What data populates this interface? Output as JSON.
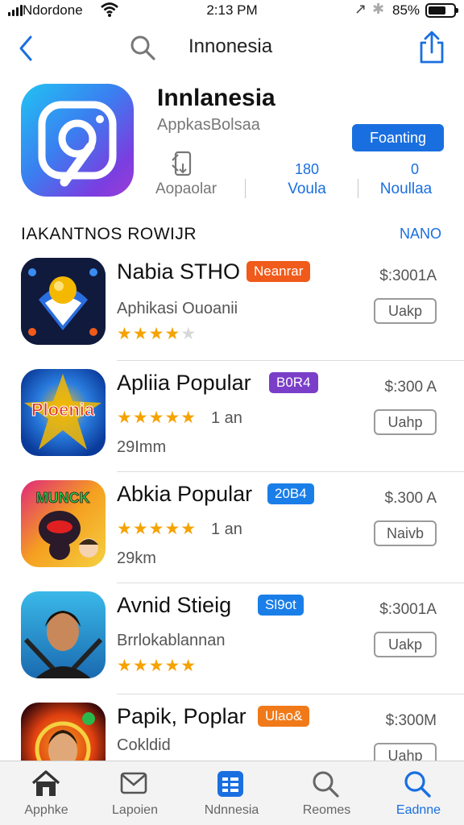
{
  "status_bar": {
    "carrier": "Ndordone",
    "time": "2:13 PM",
    "battery": "85%"
  },
  "nav": {
    "title": "Innonesia"
  },
  "hero": {
    "app_name": "Innlanesia",
    "subtitle": "AppkasBolsaa",
    "get_button": "Foanting",
    "stat1_label": "Aopaolar",
    "stat2_value": "180",
    "stat2_label": "Voula",
    "stat3_value": "0",
    "stat3_label": "Noullaa"
  },
  "section": {
    "title": "IAKANTNOS  ROWIJR",
    "more": "NANO"
  },
  "apps": [
    {
      "name": "Nabia STHO",
      "badge": "Neanrar",
      "badge_color": "#f05a1a",
      "price": "$:3001A",
      "action": "Uakp",
      "subtitle": "Aphikasi Ouoanii",
      "rating": 4,
      "rating_text": "",
      "size": ""
    },
    {
      "name": "Apliia Popular",
      "badge": "B0R4",
      "badge_color": "#7a3ec8",
      "price": "$:300 A",
      "action": "Uahp",
      "subtitle": "",
      "rating": 5,
      "rating_text": "1 an",
      "size": "29Imm"
    },
    {
      "name": "Abkia Popular",
      "badge": "20B4",
      "badge_color": "#1a7ee8",
      "price": "$.300 A",
      "action": "Naivb",
      "subtitle": "",
      "rating": 5,
      "rating_text": "1 an",
      "size": "29km"
    },
    {
      "name": "Avnid Stieig",
      "badge": "Sl9ot",
      "badge_color": "#1a7ee8",
      "price": "$:3001A",
      "action": "Uakp",
      "subtitle": "Brrlokablannan",
      "rating": 5,
      "rating_text": "",
      "size": ""
    },
    {
      "name": "Papik, Poplar",
      "badge": "Ulao&",
      "badge_color": "#f07a1a",
      "price": "$:300M",
      "action": "Uahp",
      "subtitle": "Cokldid",
      "rating": 0,
      "rating_text": "",
      "size": ""
    }
  ],
  "tabbar": {
    "tabs": [
      {
        "label": "Apphke",
        "icon": "home-icon",
        "active": false
      },
      {
        "label": "Lapoien",
        "icon": "mail-icon",
        "active": false
      },
      {
        "label": "Ndnnesia",
        "icon": "apps-icon",
        "active": false
      },
      {
        "label": "Reomes",
        "icon": "search-icon",
        "active": false
      },
      {
        "label": "Eadnne",
        "icon": "search-icon",
        "active": true
      }
    ]
  },
  "colors": {
    "accent": "#1a6fe0",
    "star": "#f5a300"
  }
}
